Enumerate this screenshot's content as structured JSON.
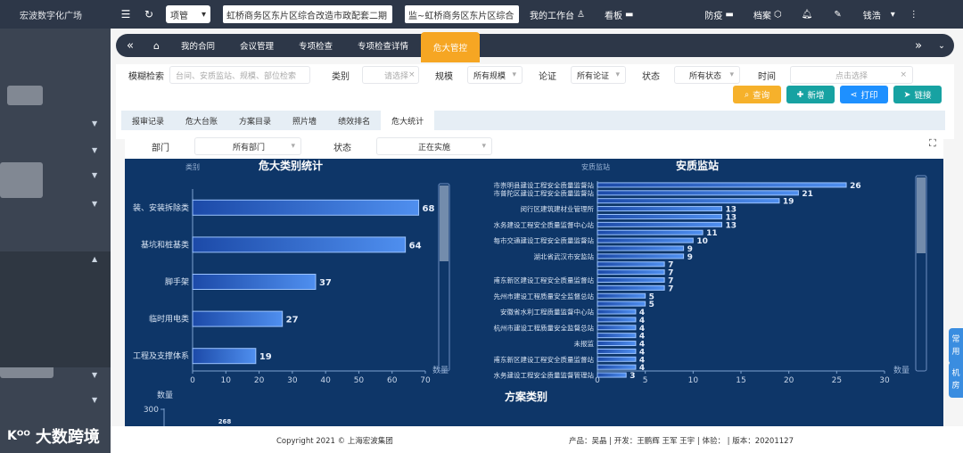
{
  "topbar": {
    "brand": "宏波数字化广场",
    "project_select": "项管",
    "nav_tab_1": "虹桥商务区东片区综合改造市政配套二期",
    "nav_tab_2": "监~虹桥商务区东片区综合",
    "workbench": "我的工作台",
    "board": "看板",
    "epidemic": "防疫",
    "archive": "档案",
    "user": "钱浩"
  },
  "main_tabs": [
    {
      "label": "我的合同"
    },
    {
      "label": "会议管理"
    },
    {
      "label": "专项检查"
    },
    {
      "label": "专项检查详情"
    },
    {
      "label": "危大管控"
    }
  ],
  "filters": {
    "fuzzy_label": "模糊检索",
    "fuzzy_placeholder": "台间、安质监站、规模、部位检索",
    "category_label": "类别",
    "category_placeholder": "请选择",
    "scale_label": "规模",
    "scale_value": "所有规模",
    "demo_label": "论证",
    "demo_value": "所有论证",
    "status_label": "状态",
    "status_value": "所有状态",
    "time_label": "时间",
    "time_placeholder": "点击选择"
  },
  "actions": {
    "query": "查询",
    "add": "新增",
    "print": "打印",
    "link": "链接"
  },
  "sub_tabs": [
    {
      "label": "报审记录"
    },
    {
      "label": "危大台账"
    },
    {
      "label": "方案目录"
    },
    {
      "label": "照片墙"
    },
    {
      "label": "绩效排名"
    },
    {
      "label": "危大统计"
    }
  ],
  "sub_filter": {
    "dept_label": "部门",
    "dept_value": "所有部门",
    "status_label": "状态",
    "status_value": "正在实施"
  },
  "chart_data": [
    {
      "type": "bar",
      "orientation": "horizontal",
      "title": "危大类别统计",
      "ylabel": "类别",
      "xlabel": "数量",
      "categories": [
        "装、安装拆除类",
        "基坑和桩基类",
        "脚手架",
        "临时用电类",
        "工程及支撑体系"
      ],
      "values": [
        68,
        64,
        37,
        27,
        19
      ],
      "xlim": [
        0,
        70
      ],
      "xticks": [
        0,
        10,
        20,
        30,
        40,
        50,
        60,
        70
      ]
    },
    {
      "type": "bar",
      "orientation": "horizontal",
      "title": "安质监站",
      "ylabel": "安质监站",
      "xlabel": "数量",
      "categories": [
        "市崇明县建设工程安全质量监督站",
        "市普陀区建设工程安全质量监督站",
        "",
        "闵行区建筑建材业管理所",
        "",
        "水务建设工程安全质量监督中心站",
        "",
        "每市交通建设工程安全质量监督站",
        "",
        "湖北省武汉市安监站",
        "",
        "",
        "甫东新区建设工程安全质量监督站",
        "",
        "先州市建设工程质量安全监督总站",
        "",
        "安徽省水利工程质量监督中心站",
        "",
        "杭州市建设工程质量安全监督总站",
        "",
        "未报监",
        "",
        "甫东新区建设工程安全质量监督站",
        "",
        "水务建设工程安全质量监督管理站"
      ],
      "values": [
        26,
        21,
        19,
        13,
        13,
        13,
        11,
        10,
        9,
        9,
        7,
        7,
        7,
        7,
        5,
        5,
        4,
        4,
        4,
        4,
        4,
        4,
        4,
        4,
        3
      ],
      "xlim": [
        0,
        30
      ],
      "xticks": [
        0,
        5,
        10,
        15,
        20,
        25,
        30
      ]
    },
    {
      "type": "bar",
      "title": "方案类别",
      "ylabel": "数量",
      "yticks": [
        300
      ],
      "values": [
        268
      ]
    }
  ],
  "footer": {
    "copyright": "Copyright 2021 © 上海宏波集团",
    "credits": "产品：吴晶 | 开发：王鹏辉 王军 王宇 | 体验： | 版本：20201127"
  },
  "float": {
    "common": "常用",
    "room": "机房"
  },
  "watermark": "大数跨境",
  "colors": {
    "accent": "#f6a623",
    "dashboard_bg": "#0e3668",
    "teal": "#17a2a2",
    "blue": "#1e90ff",
    "query": "#f6b12b"
  }
}
